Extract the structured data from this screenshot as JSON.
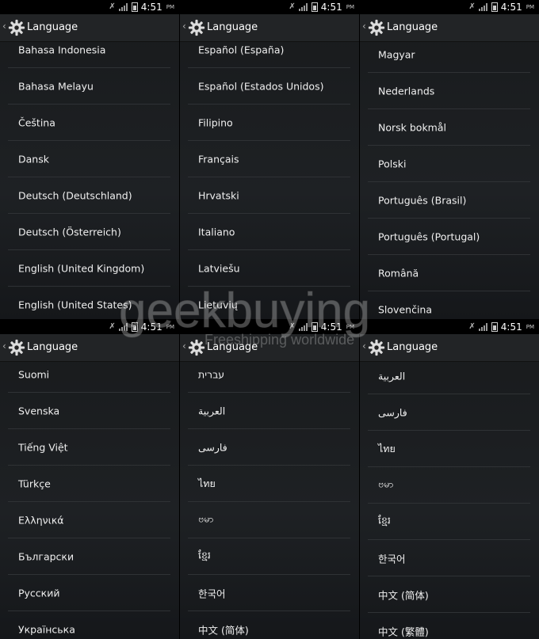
{
  "status": {
    "time": "4:51",
    "ampm": "PM"
  },
  "panels": [
    {
      "title": "Language",
      "items": [
        "Bahasa Indonesia",
        "Bahasa Melayu",
        "Čeština",
        "Dansk",
        "Deutsch (Deutschland)",
        "Deutsch (Österreich)",
        "English (United Kingdom)",
        "English (United States)"
      ]
    },
    {
      "title": "Language",
      "items": [
        "Español (España)",
        "Español (Estados Unidos)",
        "Filipino",
        "Français",
        "Hrvatski",
        "Italiano",
        "Latviešu",
        "Lietuvių"
      ]
    },
    {
      "title": "Language",
      "items": [
        "Magyar",
        "Nederlands",
        "Norsk bokmål",
        "Polski",
        "Português (Brasil)",
        "Português (Portugal)",
        "Română",
        "Slovenčina"
      ]
    },
    {
      "title": "Language",
      "items": [
        "Suomi",
        "Svenska",
        "Tiếng Việt",
        "Türkçe",
        "Ελληνικά",
        "Български",
        "Русский",
        "Українська"
      ]
    },
    {
      "title": "Language",
      "items": [
        "עברית",
        "العربية",
        "فارسی",
        "ไทย",
        "ဗမာ",
        "ខ្មែរ",
        "한국어",
        "中文 (简体)"
      ]
    },
    {
      "title": "Language",
      "items": [
        "العربية",
        "فارسی",
        "ไทย",
        "ဗမာ",
        "ខ្មែរ",
        "한국어",
        "中文 (简体)",
        "中文 (繁體)"
      ]
    }
  ],
  "watermark": {
    "brand": "geekbuying",
    "tagline": "Freeshipping worldwide"
  },
  "colors": {
    "background": "#1c1e21",
    "divider": "#2f3235",
    "actionbar": "#222426"
  }
}
